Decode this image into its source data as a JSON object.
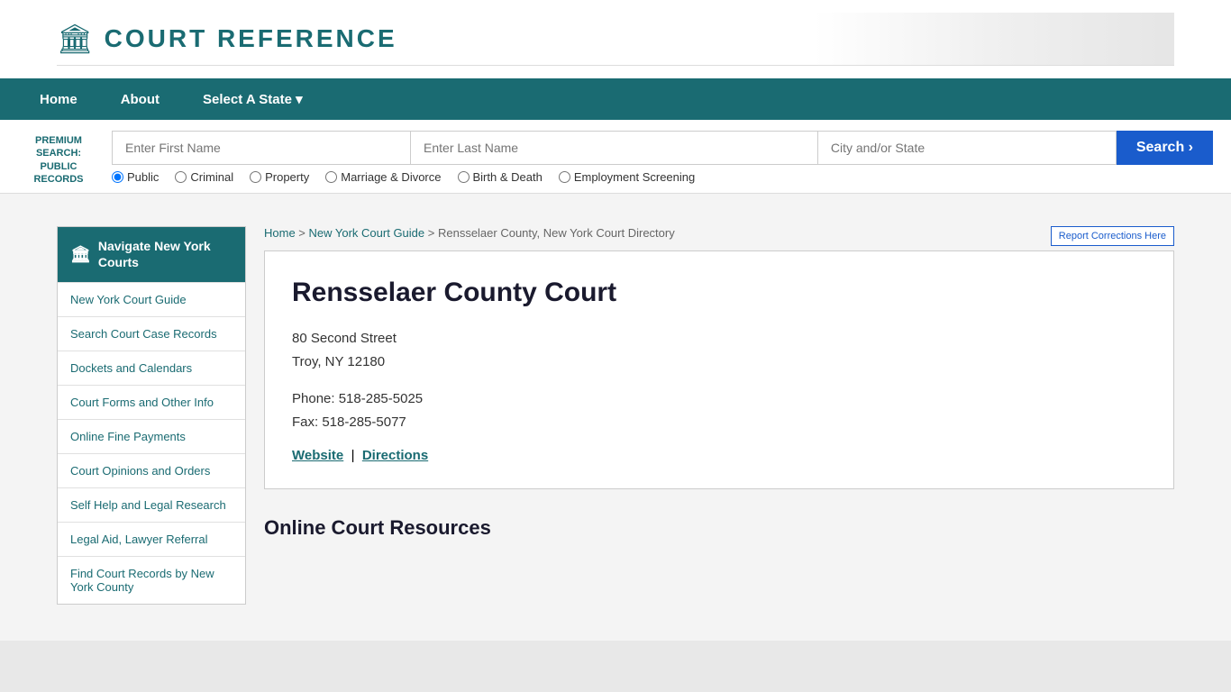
{
  "header": {
    "logo_text": "COURT REFERENCE",
    "logo_icon": "🏛"
  },
  "nav": {
    "items": [
      {
        "label": "Home",
        "id": "home"
      },
      {
        "label": "About",
        "id": "about"
      },
      {
        "label": "Select A State ▾",
        "id": "select-state"
      }
    ]
  },
  "search": {
    "premium_label": "PREMIUM SEARCH: PUBLIC RECORDS",
    "first_name_placeholder": "Enter First Name",
    "last_name_placeholder": "Enter Last Name",
    "city_placeholder": "City and/or State",
    "button_label": "Search  ›",
    "radio_options": [
      {
        "label": "Public",
        "checked": true
      },
      {
        "label": "Criminal",
        "checked": false
      },
      {
        "label": "Property",
        "checked": false
      },
      {
        "label": "Marriage & Divorce",
        "checked": false
      },
      {
        "label": "Birth & Death",
        "checked": false
      },
      {
        "label": "Employment Screening",
        "checked": false
      }
    ]
  },
  "breadcrumb": {
    "home": "Home",
    "guide": "New York Court Guide",
    "current": "Rensselaer County, New York Court Directory"
  },
  "report_button": "Report Corrections Here",
  "sidebar": {
    "header": "Navigate New York Courts",
    "links": [
      "New York Court Guide",
      "Search Court Case Records",
      "Dockets and Calendars",
      "Court Forms and Other Info",
      "Online Fine Payments",
      "Court Opinions and Orders",
      "Self Help and Legal Research",
      "Legal Aid, Lawyer Referral",
      "Find Court Records by New York County"
    ]
  },
  "court": {
    "title": "Rensselaer County Court",
    "address_line1": "80 Second Street",
    "address_line2": "Troy, NY 12180",
    "phone": "Phone: 518-285-5025",
    "fax": "Fax: 518-285-5077",
    "website_label": "Website",
    "directions_label": "Directions"
  },
  "online_resources": {
    "heading": "Online Court Resources"
  }
}
